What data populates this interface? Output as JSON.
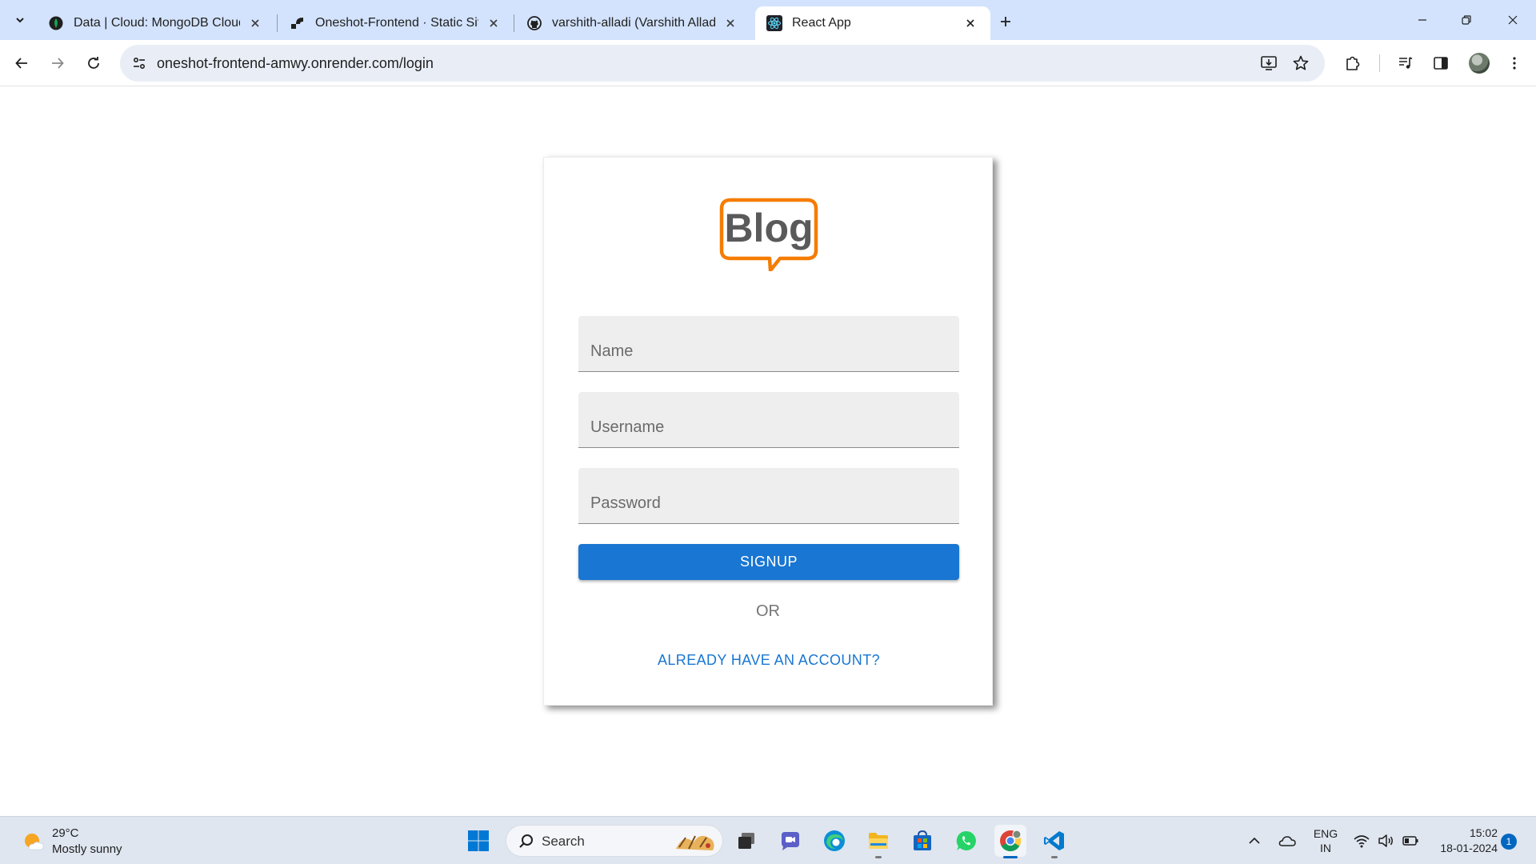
{
  "browser": {
    "tabs": [
      {
        "title": "Data | Cloud: MongoDB Cloud",
        "icon": "mongodb-leaf-icon",
        "active": false
      },
      {
        "title": "Oneshot-Frontend · Static Site",
        "icon": "render-logo-icon",
        "active": false
      },
      {
        "title": "varshith-alladi (Varshith Alladi)",
        "icon": "github-icon",
        "active": false
      },
      {
        "title": "React App",
        "icon": "react-icon",
        "active": true
      }
    ],
    "url": "oneshot-frontend-amwy.onrender.com/login"
  },
  "page": {
    "logo_text": "Blog",
    "fields": {
      "name_placeholder": "Name",
      "username_placeholder": "Username",
      "password_placeholder": "Password"
    },
    "signup_label": "SIGNUP",
    "or_text": "OR",
    "login_link": "ALREADY HAVE AN ACCOUNT?",
    "accent_color": "#1976d2",
    "logo_color": "#f57c00"
  },
  "taskbar": {
    "weather_temp": "29°C",
    "weather_desc": "Mostly sunny",
    "search_label": "Search",
    "lang_line1": "ENG",
    "lang_line2": "IN",
    "time": "15:02",
    "date": "18-01-2024",
    "notification_count": "1"
  }
}
